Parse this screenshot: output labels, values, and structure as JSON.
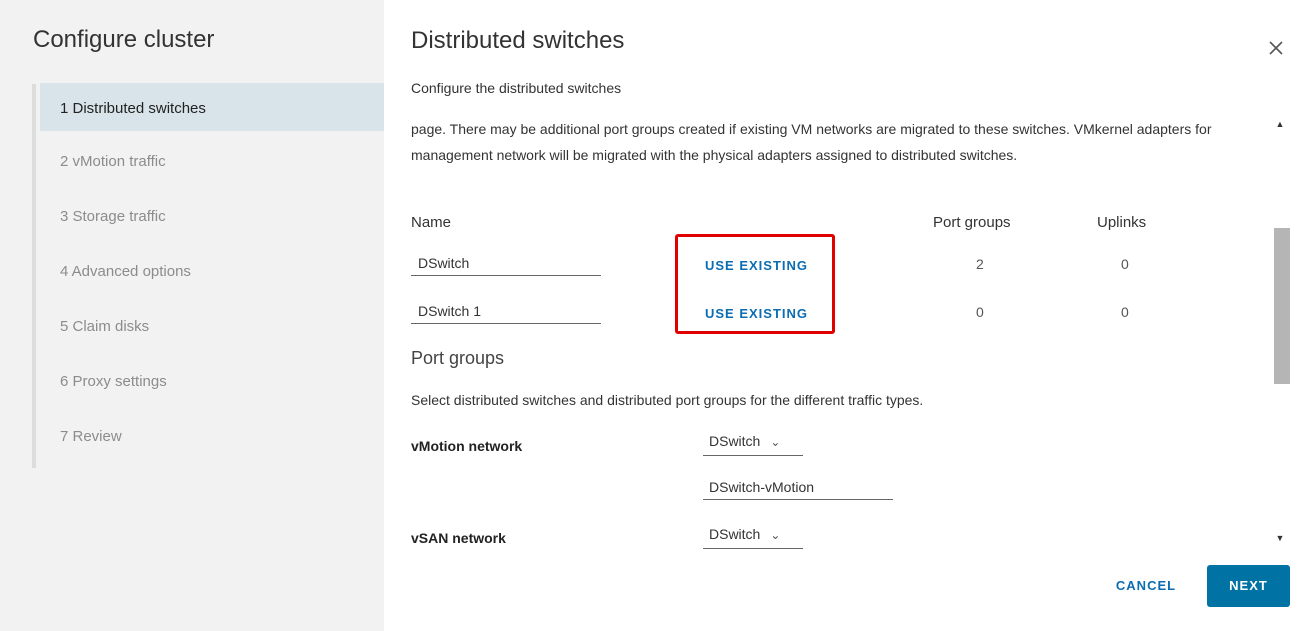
{
  "sidebar": {
    "title": "Configure cluster",
    "steps": [
      {
        "label": "1  Distributed switches"
      },
      {
        "label": "2  vMotion traffic"
      },
      {
        "label": "3  Storage traffic"
      },
      {
        "label": "4  Advanced options"
      },
      {
        "label": "5  Claim disks"
      },
      {
        "label": "6  Proxy settings"
      },
      {
        "label": "7  Review"
      }
    ]
  },
  "main": {
    "title": "Distributed switches",
    "subtitle": "Configure the distributed switches",
    "intro": "page. There may be additional port groups created if existing VM networks are migrated to these switches. VMkernel adapters for management network will be migrated with the physical adapters assigned to distributed switches.",
    "columns": {
      "name": "Name",
      "port_groups": "Port groups",
      "uplinks": "Uplinks"
    },
    "switches": [
      {
        "name": "DSwitch",
        "action": "USE EXISTING",
        "port_groups": "2",
        "uplinks": "0"
      },
      {
        "name": "DSwitch 1",
        "action": "USE EXISTING",
        "port_groups": "0",
        "uplinks": "0"
      }
    ],
    "port_groups_section": {
      "title": "Port groups",
      "description": "Select distributed switches and distributed port groups for the different traffic types."
    },
    "networks": [
      {
        "label": "vMotion network",
        "switch": "DSwitch",
        "port_group": "DSwitch-vMotion"
      },
      {
        "label": "vSAN network",
        "switch": "DSwitch"
      }
    ]
  },
  "footer": {
    "cancel": "CANCEL",
    "next": "NEXT"
  },
  "colors": {
    "accent": "#0072a3",
    "link": "#0b6db1",
    "highlight": "#e00000",
    "active_step": "#d9e4ea"
  }
}
